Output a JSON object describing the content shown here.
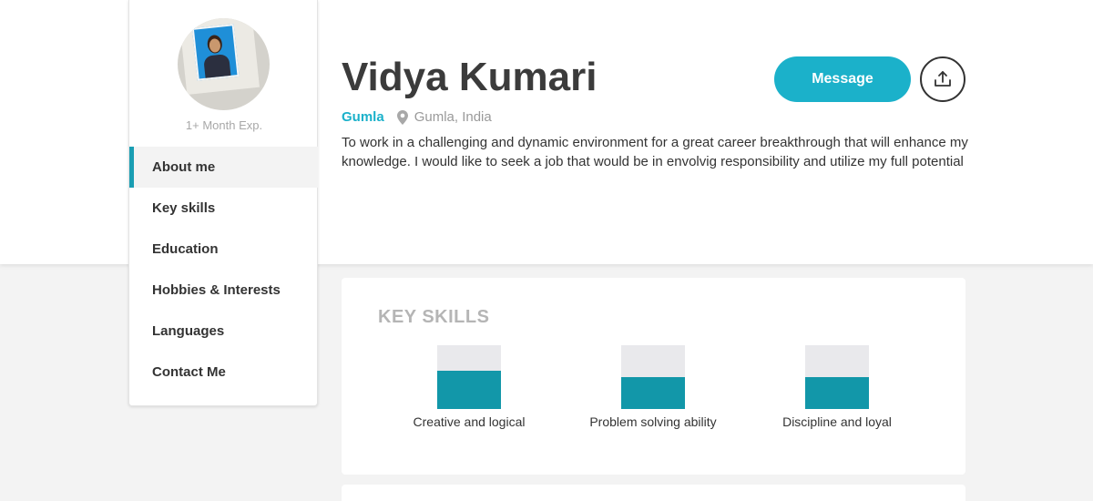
{
  "profile": {
    "experience": "1+ Month Exp.",
    "name": "Vidya Kumari",
    "city": "Gumla",
    "location": "Gumla, India",
    "summary": "To work in a challenging and dynamic environment for a great career breakthrough that will enhance my knowledge. I would like to seek a job that would be in envolvig responsibility and utilize my full potential"
  },
  "nav": {
    "items": [
      {
        "label": "About me",
        "active": true
      },
      {
        "label": "Key skills"
      },
      {
        "label": "Education"
      },
      {
        "label": "Hobbies & Interests"
      },
      {
        "label": "Languages"
      },
      {
        "label": "Contact Me"
      }
    ]
  },
  "actions": {
    "message_label": "Message",
    "share_icon": "share-upload-icon"
  },
  "key_skills": {
    "title": "KEY SKILLS",
    "items": [
      {
        "label": "Creative and logical",
        "level": 0.6
      },
      {
        "label": "Problem solving ability",
        "level": 0.5
      },
      {
        "label": "Discipline and loyal",
        "level": 0.5
      }
    ]
  },
  "colors": {
    "accent": "#1bb1ca",
    "skill_fill": "#1297a9",
    "skill_track": "#e9e9ec"
  }
}
